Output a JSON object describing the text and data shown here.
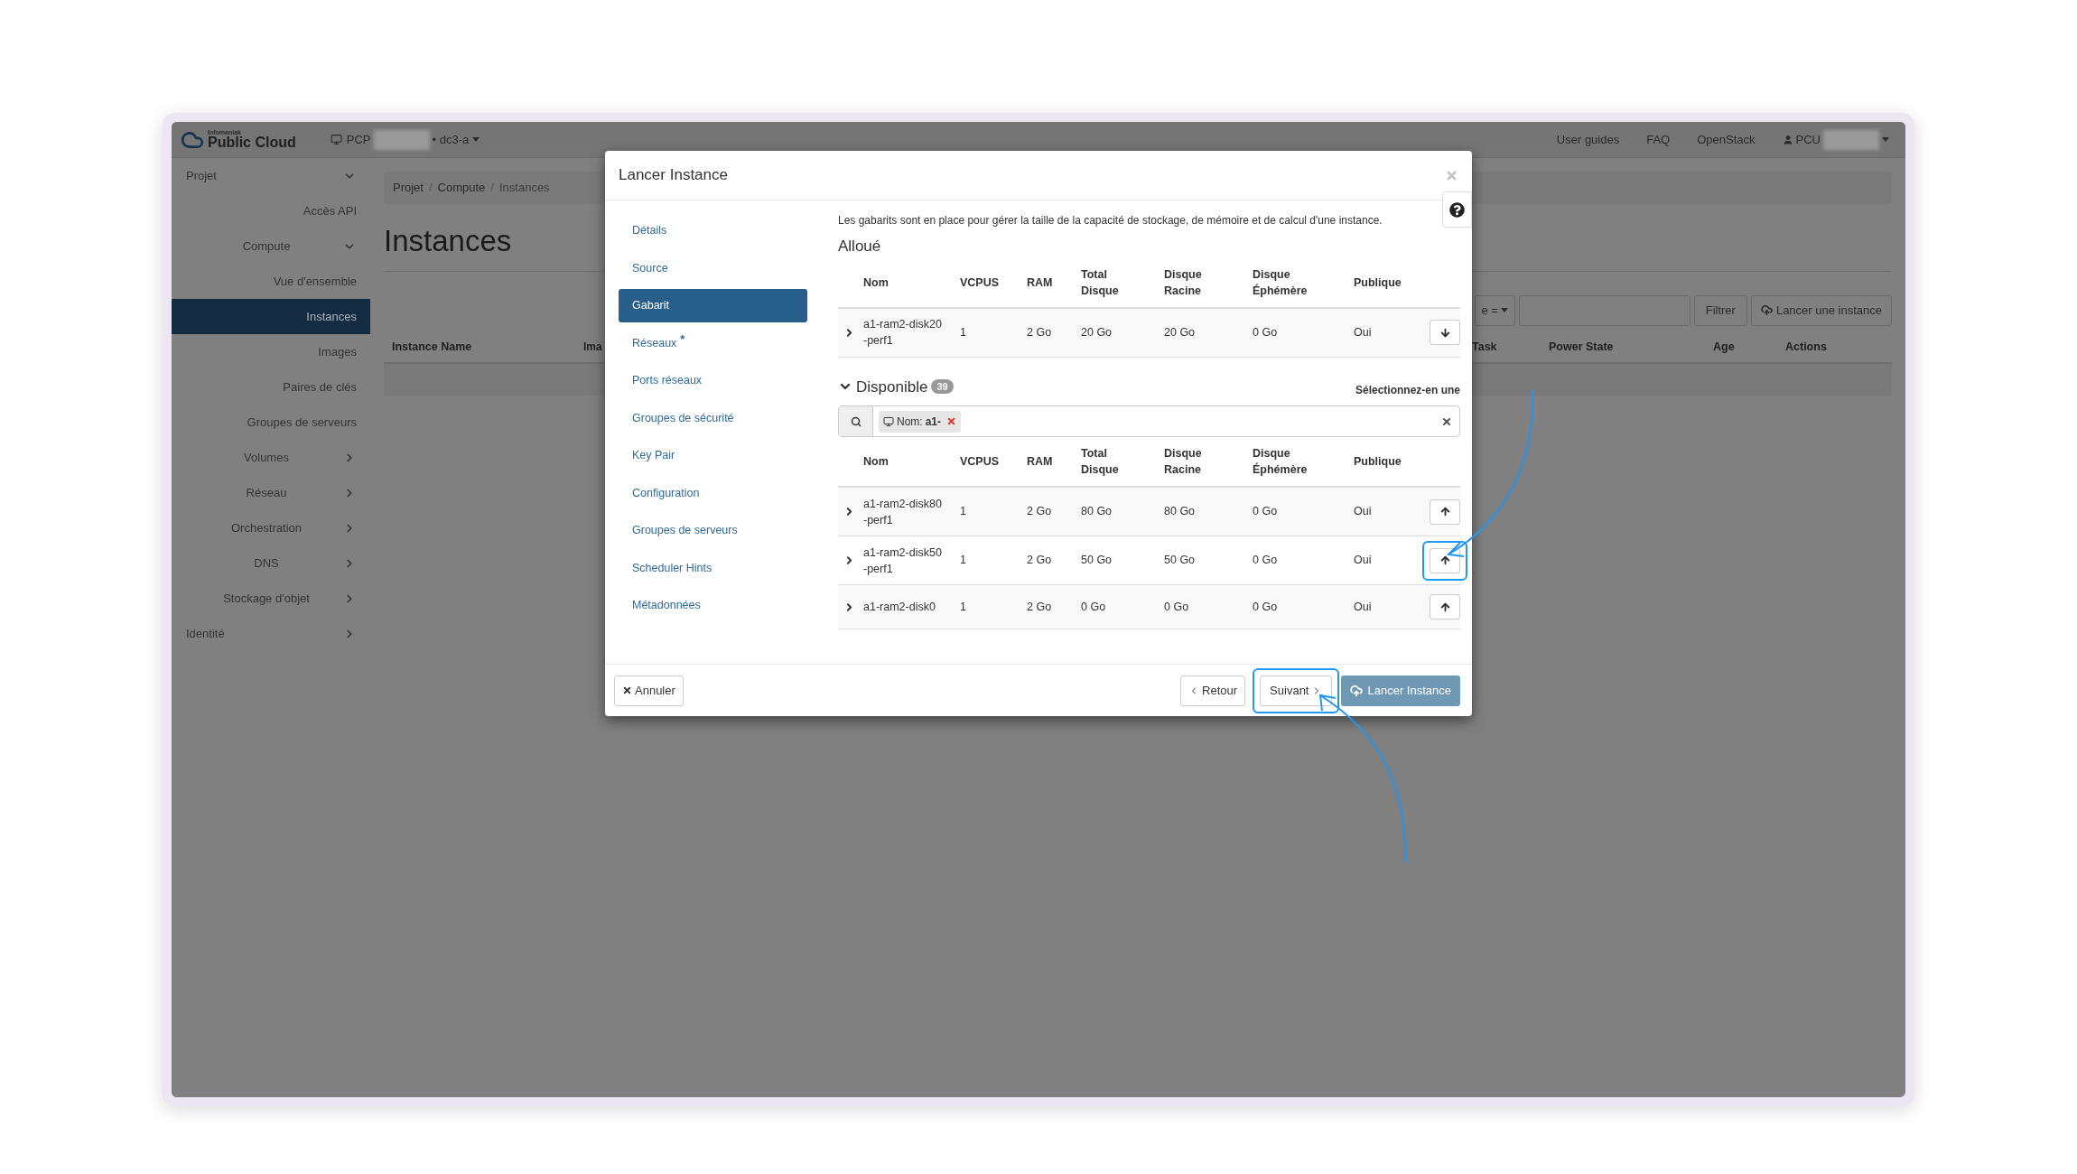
{
  "topbar": {
    "brand_small": "Infomaniak",
    "brand": "Public Cloud",
    "project": "PCP",
    "region": "• dc3-a",
    "links": [
      "User guides",
      "FAQ",
      "OpenStack"
    ],
    "user": "PCU"
  },
  "sidebar": {
    "items": [
      {
        "label": "Projet",
        "expanded": true,
        "children": [
          {
            "label": "Accès API",
            "selected": false
          },
          {
            "label": "Compute",
            "expanded": true,
            "children": [
              {
                "label": "Vue d'ensemble",
                "selected": false
              },
              {
                "label": "Instances",
                "selected": true
              },
              {
                "label": "Images",
                "selected": false
              },
              {
                "label": "Paires de clés",
                "selected": false
              },
              {
                "label": "Groupes de serveurs",
                "selected": false
              }
            ]
          },
          {
            "label": "Volumes",
            "expanded": false
          },
          {
            "label": "Réseau",
            "expanded": false
          },
          {
            "label": "Orchestration",
            "expanded": false
          },
          {
            "label": "DNS",
            "expanded": false
          },
          {
            "label": "Stockage d'objet",
            "expanded": false
          }
        ]
      },
      {
        "label": "Identité",
        "expanded": false
      }
    ]
  },
  "main": {
    "breadcrumb": [
      "Projet",
      "Compute",
      "Instances"
    ],
    "breadcrumb_separator": "/",
    "title": "Instances",
    "filter_dropdown": "e =",
    "filter_button": "Filtrer",
    "launch_button": "Lancer une instance",
    "columns_left": [
      "Instance Name",
      "Ima"
    ],
    "columns_right": [
      "Task",
      "Power State",
      "Age",
      "Actions"
    ]
  },
  "modal": {
    "title": "Lancer Instance",
    "nav": [
      {
        "label": "Détails",
        "selected": false
      },
      {
        "label": "Source",
        "selected": false
      },
      {
        "label": "Gabarit",
        "selected": true
      },
      {
        "label": "Réseaux",
        "selected": false,
        "required_mark": "*"
      },
      {
        "label": "Ports réseaux",
        "selected": false
      },
      {
        "label": "Groupes de sécurité",
        "selected": false
      },
      {
        "label": "Key Pair",
        "selected": false
      },
      {
        "label": "Configuration",
        "selected": false
      },
      {
        "label": "Groupes de serveurs",
        "selected": false
      },
      {
        "label": "Scheduler Hints",
        "selected": false
      },
      {
        "label": "Métadonnées",
        "selected": false
      }
    ],
    "description": "Les gabarits sont en place pour gérer la taille de la capacité de stockage, de mémoire et de calcul d'une instance.",
    "allocated": {
      "title": "Alloué",
      "columns": [
        "Nom",
        "VCPUS",
        "RAM",
        "Total Disque",
        "Disque Racine",
        "Disque Éphémère",
        "Publique"
      ],
      "rows": [
        {
          "expanded": false,
          "highlighted": false,
          "cells": [
            "a1-ram2-disk20-perf1",
            "1",
            "2 Go",
            "20 Go",
            "20 Go",
            "0 Go",
            "Oui"
          ]
        }
      ]
    },
    "available": {
      "title": "Disponible",
      "count": "39",
      "expanded": true,
      "hint": "Sélectionnez-en une",
      "filter_label": "Nom:",
      "filter_value": "a1-",
      "columns": [
        "Nom",
        "VCPUS",
        "RAM",
        "Total Disque",
        "Disque Racine",
        "Disque Éphémère",
        "Publique"
      ],
      "rows": [
        {
          "expanded": false,
          "highlighted": false,
          "cells": [
            "a1-ram2-disk80-perf1",
            "1",
            "2 Go",
            "80 Go",
            "80 Go",
            "0 Go",
            "Oui"
          ]
        },
        {
          "expanded": false,
          "highlighted": true,
          "cells": [
            "a1-ram2-disk50-perf1",
            "1",
            "2 Go",
            "50 Go",
            "50 Go",
            "0 Go",
            "Oui"
          ]
        },
        {
          "expanded": false,
          "highlighted": false,
          "cells": [
            "a1-ram2-disk0",
            "1",
            "2 Go",
            "0 Go",
            "0 Go",
            "0 Go",
            "Oui"
          ]
        }
      ]
    },
    "footer": {
      "cancel": "Annuler",
      "back": "Retour",
      "next": {
        "label": "Suivant",
        "highlighted": true
      },
      "launch": {
        "label": "Lancer Instance",
        "disabled": true
      }
    }
  }
}
